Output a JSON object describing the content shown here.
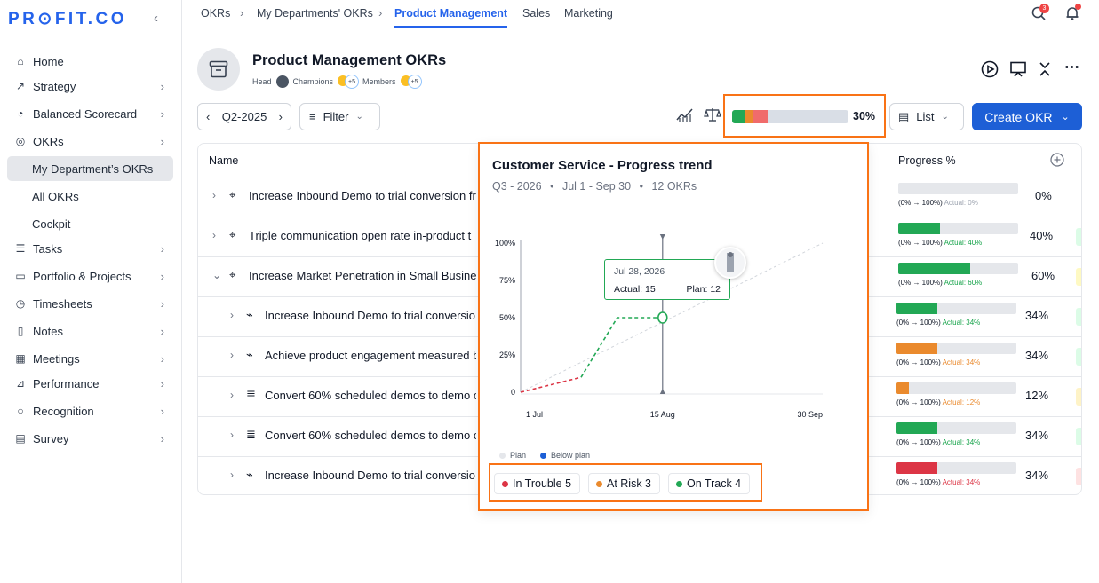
{
  "brand": {
    "logo": "PR⊙FIT.CO"
  },
  "sidebar": {
    "items": [
      {
        "label": "Home",
        "icon": "home-icon"
      },
      {
        "label": "Strategy",
        "icon": "trend-icon"
      },
      {
        "label": "Balanced Scorecard",
        "icon": "scorecard-icon"
      },
      {
        "label": "OKRs",
        "icon": "target-icon"
      },
      {
        "label": "My Department’s OKRs"
      },
      {
        "label": "All OKRs"
      },
      {
        "label": "Cockpit"
      },
      {
        "label": "Tasks",
        "icon": "tasks-icon"
      },
      {
        "label": "Portfolio & Projects",
        "icon": "folder-icon"
      },
      {
        "label": "Timesheets",
        "icon": "clock-icon"
      },
      {
        "label": "Notes",
        "icon": "notes-icon"
      },
      {
        "label": "Meetings",
        "icon": "calendar-icon"
      },
      {
        "label": "Performance",
        "icon": "chart-icon"
      },
      {
        "label": "Recognition",
        "icon": "circle-icon"
      },
      {
        "label": "Survey",
        "icon": "clipboard-icon"
      }
    ]
  },
  "topbar": {
    "crumbs": [
      "OKRs",
      "My Departments' OKRs",
      "Product Management",
      "Sales",
      "Marketing"
    ],
    "search_badge": "3"
  },
  "header": {
    "title": "Product Management OKRs",
    "head_label": "Head",
    "champions_label": "Champions",
    "champions_more": "+5",
    "members_label": "Members",
    "members_more": "+5"
  },
  "toolbar": {
    "period": "Q2-2025",
    "filter": "Filter",
    "overall_progress": "30%",
    "view": "List",
    "create": "Create OKR"
  },
  "table": {
    "col_name": "Name",
    "col_progress": "Progress %",
    "rows": [
      {
        "name": "Increase Inbound Demo to trial conversion fr",
        "range": "(0% → 100%)",
        "actual": "Actual: 0%",
        "pct": "0%",
        "fill": 0,
        "color": "#22a855",
        "actual_color": "#9ca3af"
      },
      {
        "name": "Triple communication open rate in-product t",
        "range": "(0% → 100%)",
        "actual": "Actual: 40%",
        "pct": "40%",
        "fill": 0.35,
        "color": "#22a855",
        "actual_color": "#16a34a"
      },
      {
        "name": "Increase Market Penetration in Small Busines",
        "range": "(0% → 100%)",
        "actual": "Actual: 60%",
        "pct": "60%",
        "fill": 0.6,
        "color": "#22a855",
        "actual_color": "#16a34a"
      },
      {
        "name": "Increase Inbound Demo to trial conversio",
        "range": "(0% → 100%)",
        "actual": "Actual: 34%",
        "pct": "34%",
        "fill": 0.34,
        "color": "#22a855",
        "actual_color": "#16a34a"
      },
      {
        "name": "Achieve product engagement measured b",
        "range": "(0% → 100%)",
        "actual": "Actual: 34%",
        "pct": "34%",
        "fill": 0.34,
        "color": "#ea8a2d",
        "actual_color": "#ea8a2d"
      },
      {
        "name": "Convert 60% scheduled demos to demo c",
        "range": "(0% → 100%)",
        "actual": "Actual: 12%",
        "pct": "12%",
        "fill": 0.1,
        "color": "#ea8a2d",
        "actual_color": "#ea8a2d"
      },
      {
        "name": "Convert 60% scheduled demos to demo c",
        "range": "(0% → 100%)",
        "actual": "Actual: 34%",
        "pct": "34%",
        "fill": 0.34,
        "color": "#22a855",
        "actual_color": "#16a34a"
      },
      {
        "name": "Increase Inbound Demo to trial conversio",
        "range": "(0% → 100%)",
        "actual": "Actual: 34%",
        "pct": "34%",
        "fill": 0.34,
        "color": "#dc3545",
        "actual_color": "#dc3545"
      }
    ]
  },
  "popover": {
    "title": "Customer Service - Progress trend",
    "quarter": "Q3 - 2026",
    "dates": "Jul 1 - Sep 30",
    "okrs": "12 OKRs",
    "tooltip": {
      "date": "Jul 28, 2026",
      "actual": "Actual: 15",
      "plan": "Plan: 12"
    },
    "legend": [
      "Plan",
      "Below plan"
    ],
    "status": [
      {
        "label": "In Trouble 5",
        "color": "#dc3545"
      },
      {
        "label": "At Risk 3",
        "color": "#ea8a2d"
      },
      {
        "label": "On Track 4",
        "color": "#22a855"
      }
    ]
  },
  "chart_data": {
    "type": "line",
    "x_ticks": [
      "1 Jul",
      "15 Aug",
      "30 Sep"
    ],
    "y_ticks": [
      "0",
      "25%",
      "50%",
      "75%",
      "100%"
    ],
    "ylim": [
      0,
      100
    ],
    "series": [
      {
        "name": "Plan",
        "color": "#d1d5db",
        "x": [
          0,
          1
        ],
        "y": [
          0,
          100
        ]
      },
      {
        "name": "Below plan",
        "color": "#dc3545",
        "x": [
          0,
          0.2
        ],
        "y": [
          0,
          10
        ]
      },
      {
        "color": "#22a855",
        "x": [
          0.2,
          0.32,
          0.45
        ],
        "y": [
          10,
          50,
          50
        ]
      }
    ]
  },
  "colors": {
    "accent": "#1d5fd6",
    "highlight": "#f97316"
  }
}
